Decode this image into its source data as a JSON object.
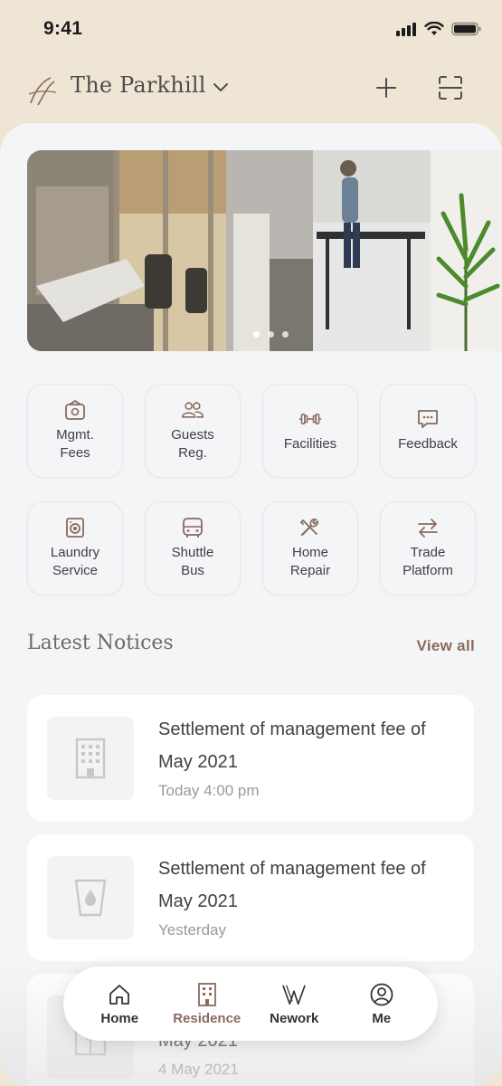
{
  "status_bar": {
    "time": "9:41"
  },
  "header": {
    "property_name": "The Parkhill"
  },
  "banner": {
    "slide_count": 3,
    "active_slide": 1
  },
  "quick_actions": [
    {
      "label": "Mgmt.\nFees",
      "icon": "wallet-icon"
    },
    {
      "label": "Guests\nReg.",
      "icon": "guests-icon"
    },
    {
      "label": "Facilities",
      "icon": "dumbbell-icon"
    },
    {
      "label": "Feedback",
      "icon": "chat-icon"
    },
    {
      "label": "Laundry\nService",
      "icon": "washing-machine-icon"
    },
    {
      "label": "Shuttle\nBus",
      "icon": "bus-icon"
    },
    {
      "label": "Home\nRepair",
      "icon": "tools-icon"
    },
    {
      "label": "Trade\nPlatform",
      "icon": "exchange-icon"
    }
  ],
  "notices": {
    "title": "Latest Notices",
    "view_all": "View all",
    "items": [
      {
        "title": "Settlement of management fee of May 2021",
        "time": "Today 4:00 pm",
        "icon": "building-icon"
      },
      {
        "title": "Settlement of management fee of May 2021",
        "time": "Yesterday",
        "icon": "water-drop-icon"
      },
      {
        "title": "Settlement of management fee of May 2021",
        "time": "4 May 2021",
        "icon": "door-icon"
      }
    ]
  },
  "tabbar": {
    "items": [
      {
        "label": "Home",
        "icon": "home-icon",
        "active": false
      },
      {
        "label": "Residence",
        "icon": "residence-icon",
        "active": true
      },
      {
        "label": "Nework",
        "icon": "network-icon",
        "active": false
      },
      {
        "label": "Me",
        "icon": "profile-icon",
        "active": false
      }
    ]
  },
  "colors": {
    "accent": "#8a6a5d",
    "header_bg": "#efe5d5",
    "page_bg": "#f4f5f7"
  }
}
